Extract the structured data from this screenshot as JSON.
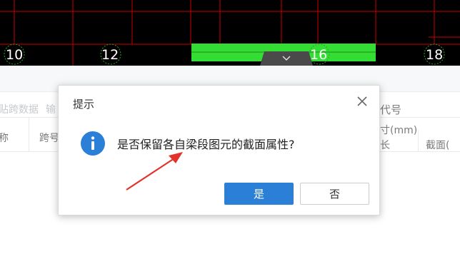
{
  "cad": {
    "axis_labels": [
      "10",
      "12",
      "16",
      "18"
    ],
    "collapse_toggle_icon": "chevron-down-icon"
  },
  "panel": {
    "toolbar_items": [
      "贴跨数据",
      "输"
    ],
    "right_headers": {
      "code": "代号",
      "size": "寸(mm)",
      "length": "长",
      "section": "截面("
    },
    "left_headers": {
      "name": "称",
      "span": "跨号"
    }
  },
  "dialog": {
    "title": "提示",
    "message": "是否保留各自梁段图元的截面属性?",
    "yes_label": "是",
    "no_label": "否",
    "icon": "info-icon",
    "close_icon": "close-icon"
  },
  "colors": {
    "accent": "#2b7fd6",
    "beam_green": "#33dd33",
    "grid_red": "#cc0000"
  }
}
